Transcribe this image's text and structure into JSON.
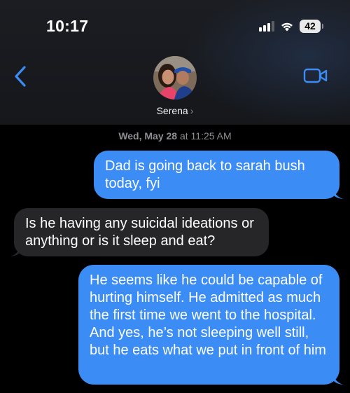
{
  "status_bar": {
    "time": "10:17",
    "battery": "42"
  },
  "header": {
    "contact_name": "Serena",
    "chevron": "›"
  },
  "thread": {
    "timestamp_day": "Wed, May 28",
    "timestamp_time": " at 11:25 AM",
    "messages": [
      {
        "direction": "outgoing",
        "text": "Dad is going back to sarah bush today, fyi"
      },
      {
        "direction": "incoming",
        "text": "Is he having any suicidal ideations or anything or is it sleep and eat?"
      },
      {
        "direction": "outgoing",
        "text": "He seems like he could be capable of hurting himself. He admitted as much the first time we went to the hospital. And yes, he’s not sleeping well still, but he eats what we put in front of him"
      }
    ]
  },
  "colors": {
    "outgoing_bubble": "#3b8cf5",
    "incoming_bubble": "#262628",
    "accent": "#3b8cf5"
  },
  "icons": [
    "signal-icon",
    "wifi-icon",
    "battery-icon",
    "back-chevron-icon",
    "video-call-icon"
  ]
}
